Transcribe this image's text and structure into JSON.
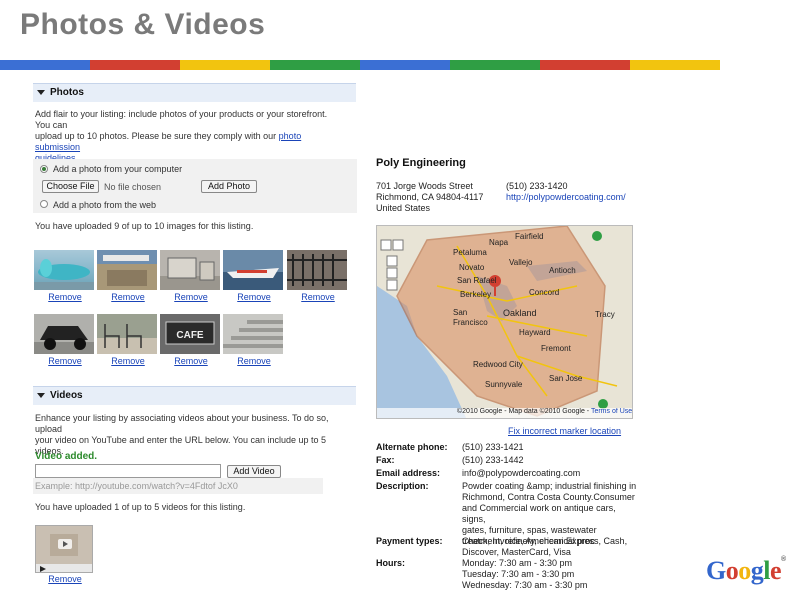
{
  "slide_title": "Photos & Videos",
  "photos_section": {
    "header": "Photos",
    "intro_line1": "Add flair to your listing: include photos of your products or your storefront. You can",
    "intro_line2": "upload up to 10 photos. Please be sure they comply with our",
    "intro_link": "photo submission",
    "intro_line3": "guidelines",
    "intro_end": ".",
    "option_computer": "Add a photo from your computer",
    "choose_file": "Choose File",
    "no_file": "No file chosen",
    "add_photo": "Add Photo",
    "option_web": "Add a photo from the web",
    "count_text": "You have uploaded 9 of up to 10 images for this listing.",
    "remove_label": "Remove"
  },
  "videos_section": {
    "header": "Videos",
    "intro_line1": "Enhance your listing by associating videos about your business. To do so, upload",
    "intro_line2": "your video on YouTube and enter the URL below. You can include up to 5 videos.",
    "video_added": "Video added.",
    "add_video": "Add Video",
    "example": "Example: http://youtube.com/watch?v=4Fdtof JcX0",
    "count_text": "You have uploaded 1 of up to 5 videos for this listing.",
    "remove_label": "Remove"
  },
  "business": {
    "name": "Poly Engineering",
    "address_line1": "701 Jorge Woods Street",
    "address_line2": "Richmond, CA 94804-4117",
    "address_line3": "United States",
    "phone": "(510) 233-1420",
    "website": "http://polypowdercoating.com/"
  },
  "map": {
    "attribution": "©2010 Google - Map data ©2010 Google -",
    "terms": "Terms of Use",
    "fix_link": "Fix incorrect marker location",
    "labels": {
      "napa": "Napa",
      "fairfield": "Fairfield",
      "petaluma": "Petaluma",
      "vallejo": "Vallejo",
      "concord": "Concord",
      "san_rafael": "San Rafael",
      "antioch": "Antioch",
      "berkeley": "Berkeley",
      "oakland": "Oakland",
      "san_francisco": "San Francisco",
      "hayward": "Hayward",
      "fremont": "Fremont",
      "redwood_city": "Redwood City",
      "sunnyvale": "Sunnyvale",
      "san_jose": "San Jose",
      "tracy": "Tracy",
      "novato": "Novato"
    }
  },
  "details": [
    {
      "label": "Alternate phone:",
      "lines": [
        "(510) 233-1421"
      ]
    },
    {
      "label": "Fax:",
      "lines": [
        "(510) 233-1442"
      ]
    },
    {
      "label": "Email address:",
      "lines": [
        "info@polypowdercoating.com"
      ]
    },
    {
      "label": "Description:",
      "lines": [
        "Powder coating &amp; industrial finishing in",
        "Richmond, Contra Costa County.Consumer",
        "and Commercial work on antique cars, signs,",
        "gates, furniture, spas, wastewater",
        "treatment, refinery, chemical proc"
      ]
    },
    {
      "label": "Payment types:",
      "lines": [
        "Check, Invoice, American Express, Cash,",
        "Discover, MasterCard, Visa"
      ]
    },
    {
      "label": "Hours:",
      "lines": [
        "Monday: 7:30 am - 3:30 pm",
        "Tuesday: 7:30 am - 3:30 pm",
        "Wednesday: 7:30 am - 3:30 pm"
      ]
    }
  ],
  "google_logo": {
    "letters": [
      "G",
      "o",
      "o",
      "g",
      "l",
      "e"
    ],
    "colors": [
      "#3366cc",
      "#d23f31",
      "#f2b50f",
      "#3366cc",
      "#2f9e44",
      "#d23f31"
    ],
    "tm": "®"
  },
  "colors": {
    "stripe": [
      "#3b6fd4",
      "#d23f31",
      "#f2c40f",
      "#2f9e44",
      "#3b6fd4",
      "#2f9e44",
      "#d23f31",
      "#f2c40f"
    ]
  }
}
